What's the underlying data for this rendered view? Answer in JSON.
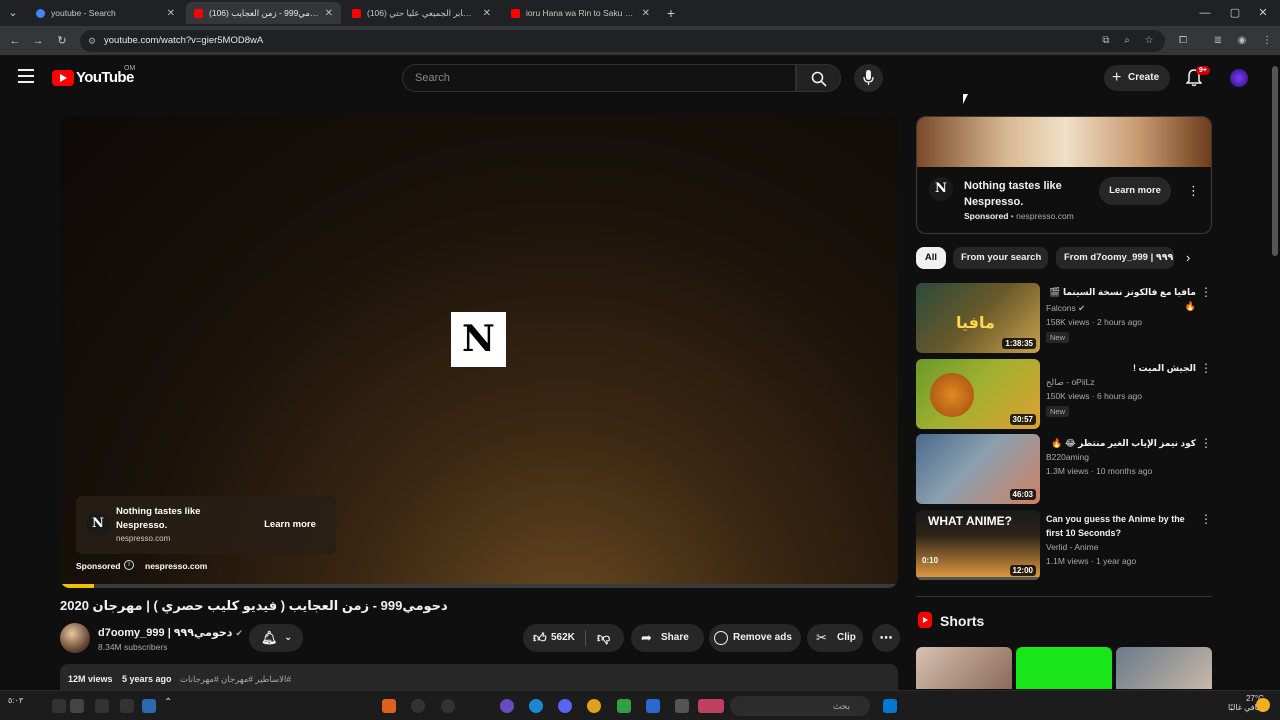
{
  "browser": {
    "tabs": [
      {
        "label": "youtube - Search",
        "active": false,
        "favicon_color": "#4285f4"
      },
      {
        "label": "دحومي999 - زمن العجايب (106)",
        "active": true,
        "favicon_color": "#ff0000"
      },
      {
        "label": "(106) صابر الجميعي عليا حتي - ...",
        "active": false,
        "favicon_color": "#ff0000"
      },
      {
        "label": "ioru Hana wa Rin to Saku الحي",
        "active": false,
        "favicon_color": "#ff0000"
      }
    ],
    "url": "youtube.com/watch?v=gier5MOD8wA"
  },
  "youtube": {
    "logo_text": "YouTube",
    "country_code": "OM",
    "search_placeholder": "Search",
    "create_label": "Create",
    "notification_count": "9+"
  },
  "video": {
    "ad": {
      "headline": "Nothing tastes like Nespresso.",
      "domain": "nespresso.com",
      "cta": "Learn more",
      "sponsored": "Sponsored",
      "brand_letter": "N"
    },
    "title": "دحومي999 - زمن العجايب ( فيديو كليب حصري ) | مهرجان 2020",
    "channel_name": "d7oomy_999 | دحومي٩٩٩",
    "subscribers": "8.34M subscribers",
    "likes": "562K",
    "share_label": "Share",
    "remove_ads_label": "Remove ads",
    "clip_label": "Clip",
    "views": "12M views",
    "age": "5 years ago",
    "hashtags": "#الاساطير #مهرجان #مهرجانات"
  },
  "sidebar": {
    "ad": {
      "headline": "Nothing tastes like Nespresso.",
      "sponsored": "Sponsored",
      "domain": "nespresso.com",
      "cta": "Learn more"
    },
    "chips": [
      "All",
      "From your search",
      "From d7oomy_999 | ٩٩٩"
    ],
    "recommendations": [
      {
        "title": "مافيا مع فالكونز نسخة السينما 🎬 🔥",
        "channel": "Falcons",
        "meta": "158K views · 2 hours ago",
        "badge": "New",
        "duration": "1:38:35",
        "thumb_colors": [
          "#2b4a3a",
          "#c9a14a"
        ]
      },
      {
        "title": "الجيش الميت !",
        "channel": "صالح - oPiiLz",
        "meta": "150K views · 6 hours ago",
        "badge": "New",
        "duration": "30:57",
        "thumb_colors": [
          "#6a9a2a",
          "#e0a030"
        ]
      },
      {
        "title": "كود نيمز الإياب الغير منتظر 😂 🔥",
        "channel": "B220aming",
        "meta": "1.3M views · 10 months ago",
        "badge": "",
        "duration": "46:03",
        "thumb_colors": [
          "#4a6a8a",
          "#d08060"
        ]
      },
      {
        "title": "Can you guess the Anime by the first 10 Seconds?",
        "channel": "Verlid - Anime",
        "meta": "1.1M views · 1 year ago",
        "badge": "",
        "duration": "12:00",
        "progress_label": "0:10",
        "thumb_text": "WHAT ANIME?",
        "thumb_colors": [
          "#1a1a1a",
          "#e8a040"
        ]
      }
    ],
    "shorts_label": "Shorts"
  },
  "taskbar": {
    "search_placeholder": "بحث",
    "weather": "27°C",
    "weather_desc": "صافي غالبًا",
    "time": "٥:٠٣"
  }
}
